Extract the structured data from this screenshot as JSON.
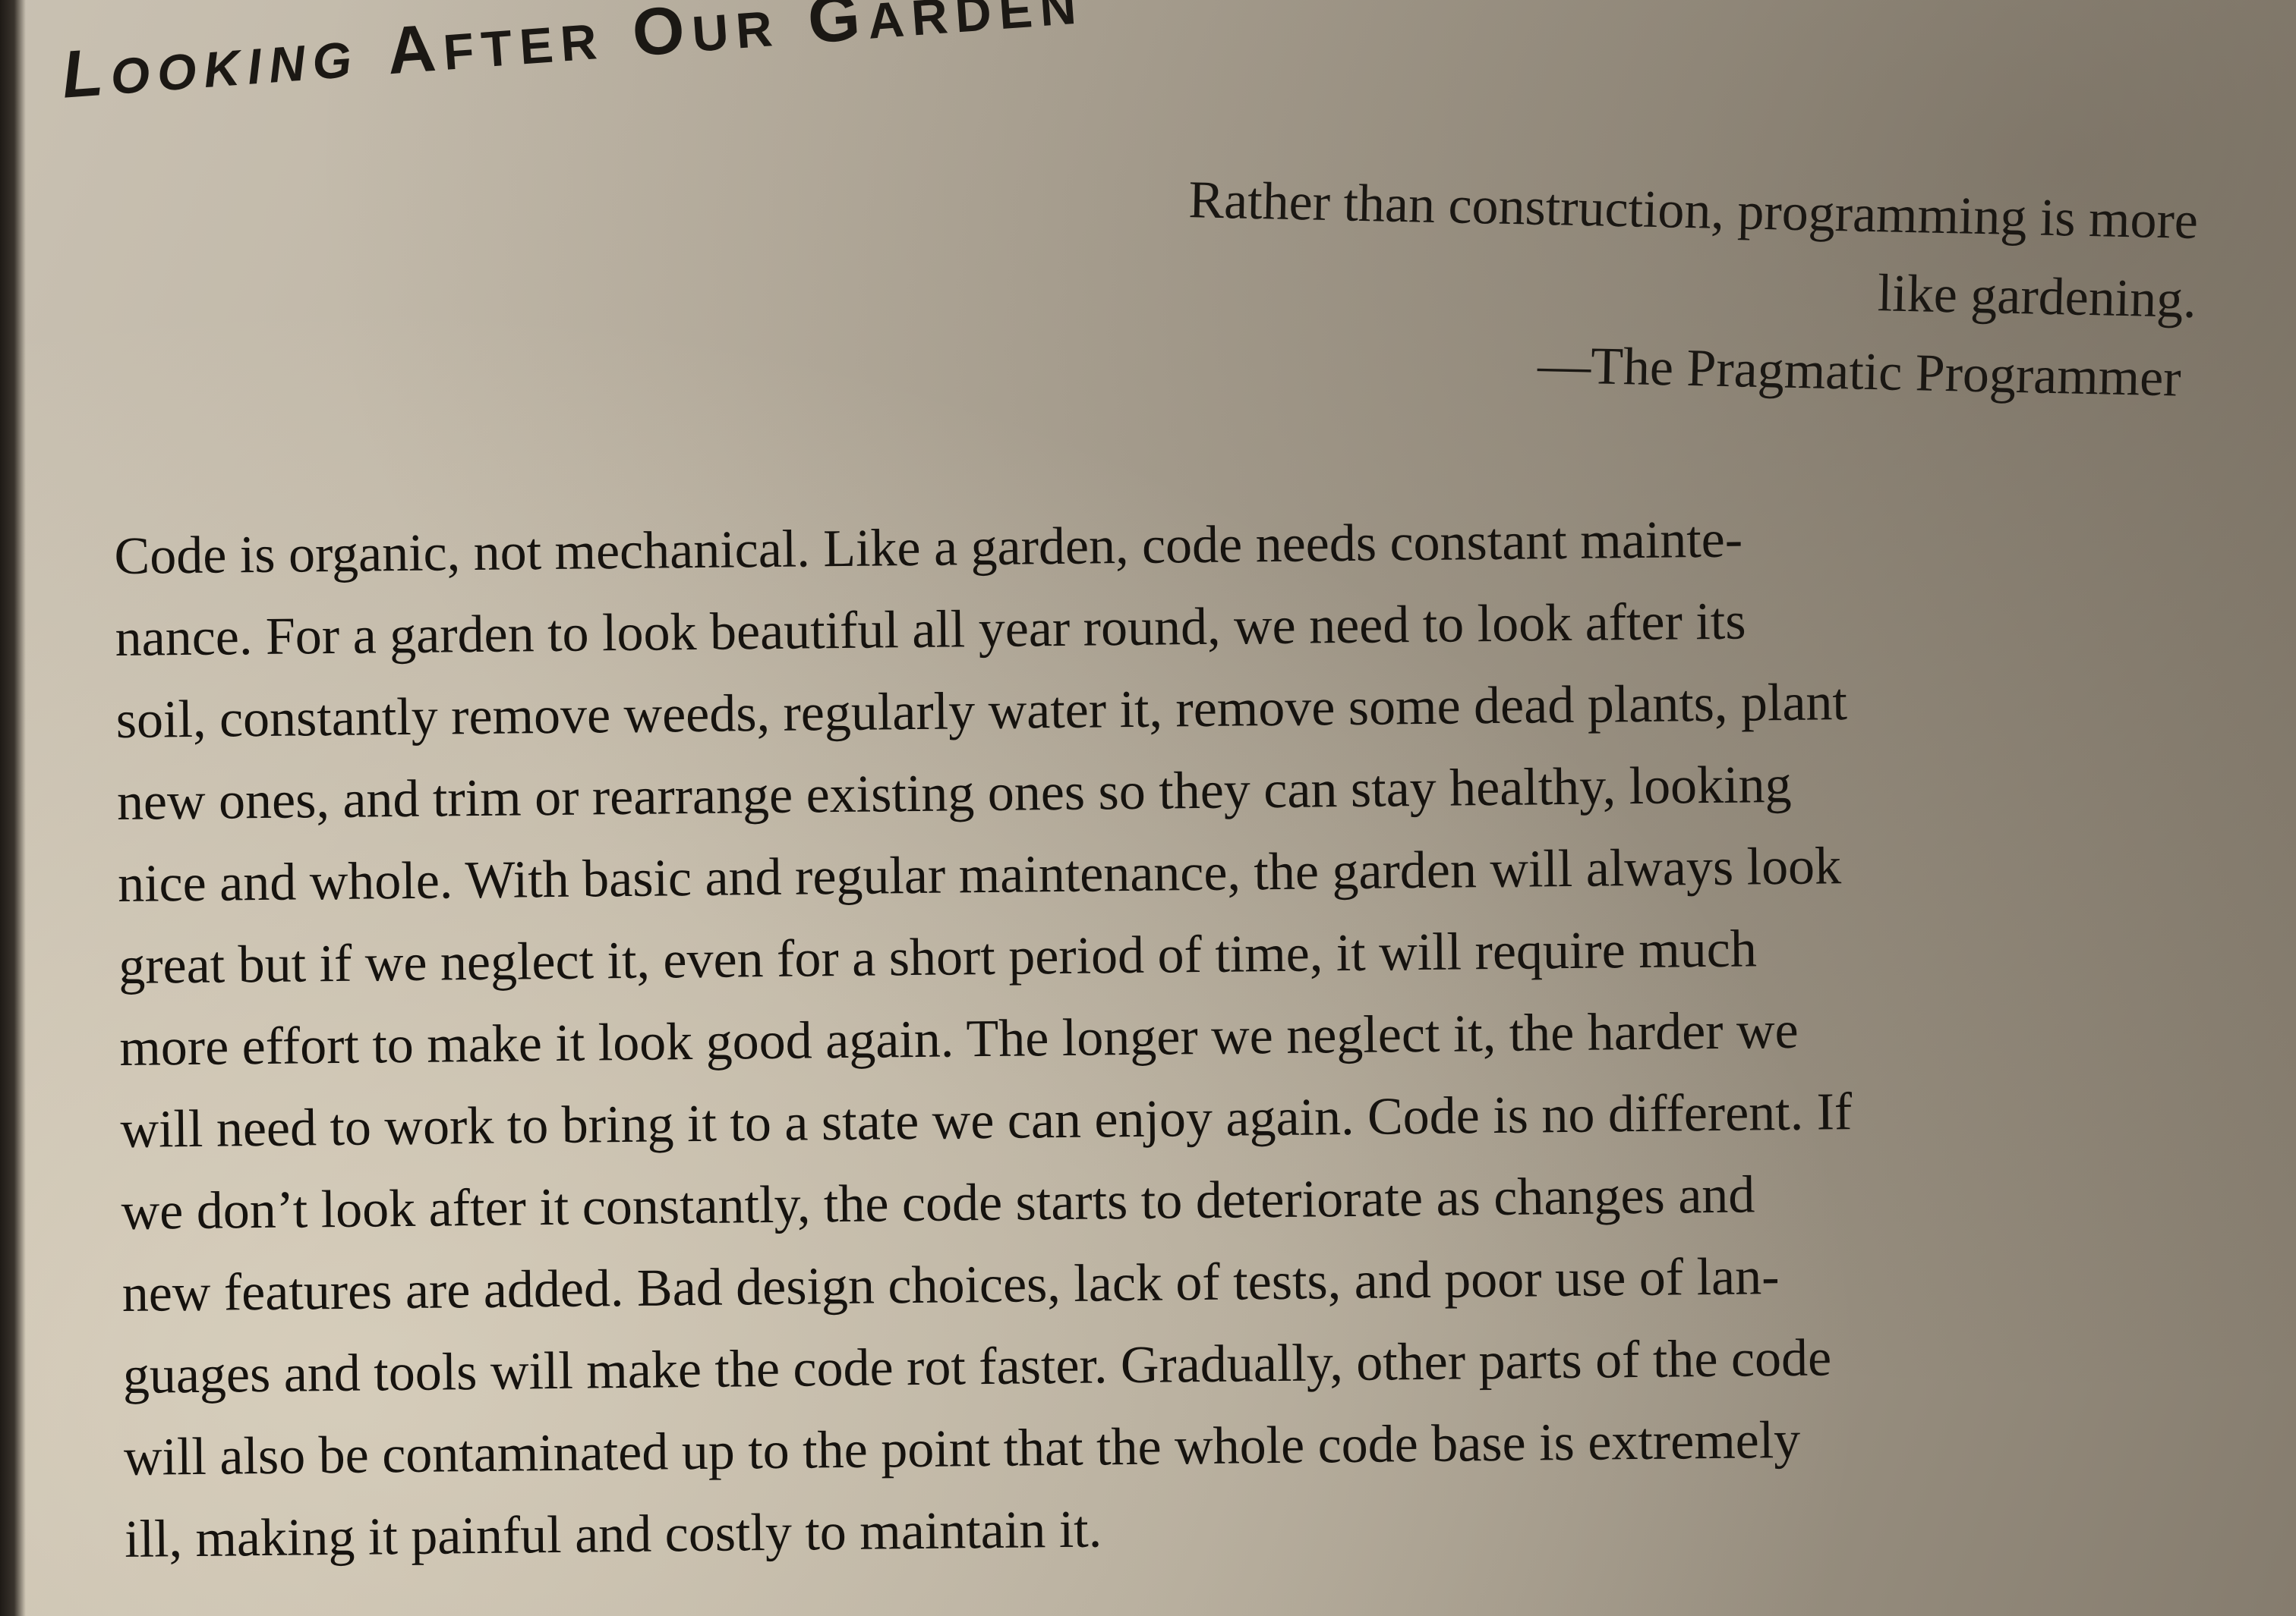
{
  "heading": {
    "words": [
      {
        "initial": "L",
        "rest": "OOKING"
      },
      {
        "initial": "A",
        "rest": "FTER"
      },
      {
        "initial": "O",
        "rest": "UR"
      },
      {
        "initial": "G",
        "rest": "ARDEN"
      }
    ]
  },
  "epigraph": {
    "lines": [
      "Rather than construction, programming is more",
      "like gardening."
    ],
    "attribution": "—The Pragmatic Programmer"
  },
  "body": {
    "lines": [
      "Code is organic, not mechanical. Like a garden, code needs constant mainte-",
      "nance. For a garden to look beautiful all year round, we need to look after its",
      "soil, constantly remove weeds, regularly water it, remove some dead plants, plant",
      "new ones, and trim or rearrange existing ones so they can stay healthy, looking",
      "nice and whole. With basic and regular maintenance, the garden will always look",
      "great but if we neglect it, even for a short period of time, it will require much",
      "more effort to make it look good again. The longer we neglect it, the harder we",
      "will need to work to bring it to a state we can enjoy again. Code is no different. If",
      "we don’t look after it constantly, the code starts to deteriorate as changes and",
      "new features are added. Bad design choices, lack of tests, and poor use of lan-",
      "guages and tools will make the code rot faster. Gradually, other parts of the code",
      "will also be contaminated up to the point that the whole code base is extremely",
      "ill, making it painful and costly to maintain it."
    ]
  }
}
